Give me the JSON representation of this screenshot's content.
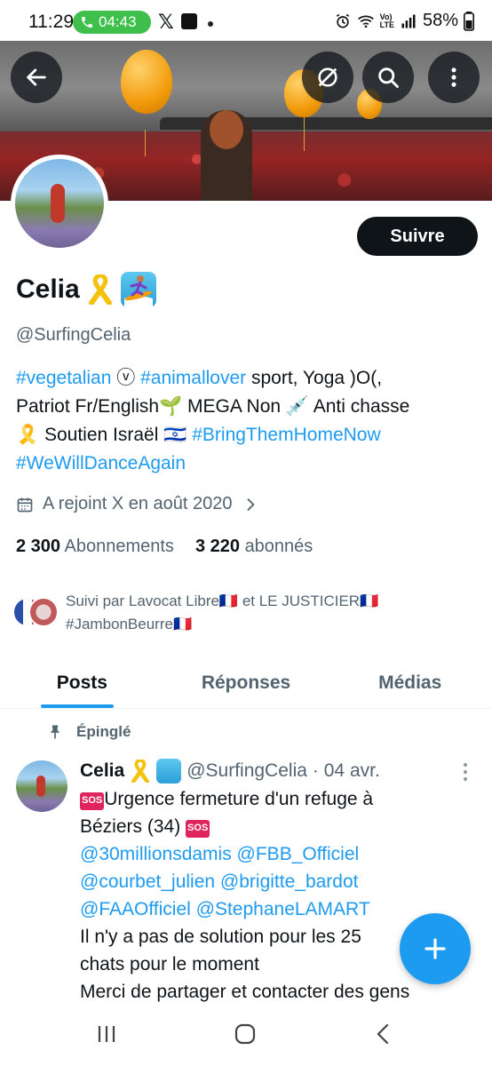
{
  "status_bar": {
    "time": "11:29",
    "call_timer": "04:43",
    "battery": "58%",
    "network": "LTE"
  },
  "banner": {
    "icons": [
      "back-arrow-icon",
      "hide-icon",
      "search-icon",
      "more-vert-icon"
    ]
  },
  "profile": {
    "name": "Celia",
    "name_emojis": [
      "yellow-ribbon",
      "surfer"
    ],
    "handle": "@SurfingCelia",
    "follow_label": "Suivre",
    "bio": {
      "line1_tag1": "#vegetalian",
      "line1_mid": " ⓥ ",
      "line1_tag2": "#animallover",
      "line1_rest": " sport, Yoga )O(,",
      "line2": "Patriot  Fr/English🌱 MEGA Non 💉 Anti chasse",
      "line3_start": "🎗️ Soutien Israël 🇮🇱 ",
      "line3_tag": "#BringThemHomeNow",
      "line4_tag": "#WeWillDanceAgain"
    },
    "joined": "A rejoint X en août 2020",
    "following_count": "2 300",
    "following_label": "Abonnements",
    "followers_count": "3 220",
    "followers_label": "abonnés",
    "followed_by_line1": "Suivi par Lavocat Libre🇫🇷 et LE JUSTICIER🇫🇷",
    "followed_by_line2": "#JambonBeurre🇫🇷"
  },
  "tabs": [
    {
      "label": "Posts",
      "active": true
    },
    {
      "label": "Réponses",
      "active": false
    },
    {
      "label": "Médias",
      "active": false
    }
  ],
  "post": {
    "pinned_label": "Épinglé",
    "author": "Celia",
    "author_handle": "@SurfingCelia",
    "date": "· 04 avr.",
    "sos": "SOS",
    "line1": "Urgence fermeture d'un refuge à",
    "line2": "Béziers (34) ",
    "mentions1": "@30millionsdamis @FBB_Officiel",
    "mentions2": "@courbet_julien @brigitte_bardot",
    "mentions3": "@FAAOfficiel @StephaneLAMART",
    "line3": "Il n'y a pas de solution pour les 25",
    "line4": "chats pour le moment",
    "line5": "Merci de partager et contacter des gens"
  },
  "colors": {
    "accent": "#1d9bf0",
    "text": "#0f1419",
    "muted": "#536471",
    "follow_button": "#0f1419",
    "call_pill": "#3fbf4c"
  }
}
